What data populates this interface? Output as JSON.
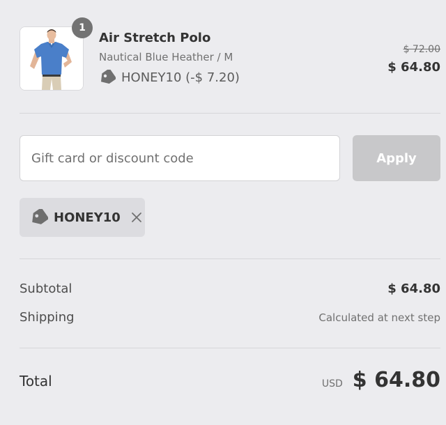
{
  "product": {
    "quantity": "1",
    "title": "Air Stretch Polo",
    "variant": "Nautical Blue Heather / M",
    "discount_line": "HONEY10 (-$ 7.20)",
    "original_price": "$ 72.00",
    "price": "$ 64.80",
    "shirt_color": "#4a7fc9"
  },
  "discount_form": {
    "placeholder": "Gift card or discount code",
    "apply_label": "Apply"
  },
  "applied_discount": {
    "code": "HONEY10"
  },
  "summary": {
    "subtotal_label": "Subtotal",
    "subtotal_value": "$ 64.80",
    "shipping_label": "Shipping",
    "shipping_value": "Calculated at next step"
  },
  "total": {
    "label": "Total",
    "currency": "USD",
    "amount": "$ 64.80"
  },
  "icons": {
    "tag": "tag-icon",
    "remove": "close-icon"
  },
  "colors": {
    "background": "#ececef",
    "apply_disabled": "#c8c8ca",
    "chip_background": "#dcdce0",
    "badge": "#737373"
  }
}
